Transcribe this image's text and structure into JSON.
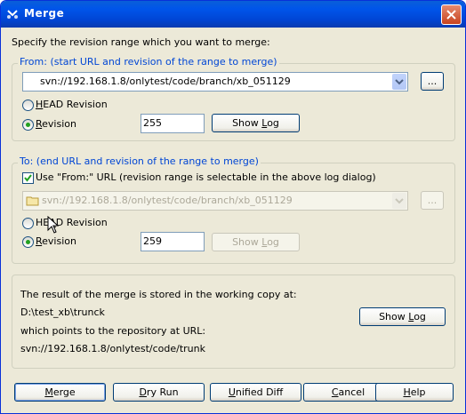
{
  "window": {
    "title": "Merge",
    "app_icon": "tortoisesvn-merge-icon"
  },
  "intro": "Specify the revision range which you want to merge:",
  "from": {
    "legend": "From: (start URL and revision of the range to merge)",
    "url": "svn://192.168.1.8/onlytest/code/branch/xb_051129",
    "browse_label": "...",
    "head_label_pre": "H",
    "head_label_post": "EAD Revision",
    "rev_label_pre": "R",
    "rev_label_post": "evision",
    "selected": "revision",
    "revision": "255",
    "showlog_pre": "Show ",
    "showlog_u": "L",
    "showlog_post": "og"
  },
  "to": {
    "legend": "To: (end URL and revision of the range to merge)",
    "use_from_label": "Use \"From:\" URL (revision range is selectable in the above log dialog)",
    "use_from_checked": true,
    "url": "svn://192.168.1.8/onlytest/code/branch/xb_051129",
    "browse_label": "...",
    "head_label_pre": "HE",
    "head_label_u": "A",
    "head_label_post": "D Revision",
    "rev_label_pre": "R",
    "rev_label_post": "evision",
    "selected": "revision",
    "revision": "259",
    "showlog_pre": "Show ",
    "showlog_u": "L",
    "showlog_post": "og"
  },
  "result": {
    "line1": "The result of the merge is stored in the working copy at:",
    "path": "D:\\test_xb\\trunck",
    "line2": "which points to the repository at URL:",
    "url": "svn://192.168.1.8/onlytest/code/trunk",
    "showlog_pre": "Show ",
    "showlog_u": "L",
    "showlog_post": "og"
  },
  "buttons": {
    "merge_u": "M",
    "merge_post": "erge",
    "dryrun_pre": "D",
    "dryrun_post": "ry Run",
    "diff_u": "U",
    "diff_post": "nified Diff",
    "cancel_u": "C",
    "cancel_post": "ancel",
    "help_u": "H",
    "help_post": "elp"
  },
  "colors": {
    "titlebar": "#0055ea",
    "face": "#ece9d8",
    "legend": "#0046d5"
  }
}
